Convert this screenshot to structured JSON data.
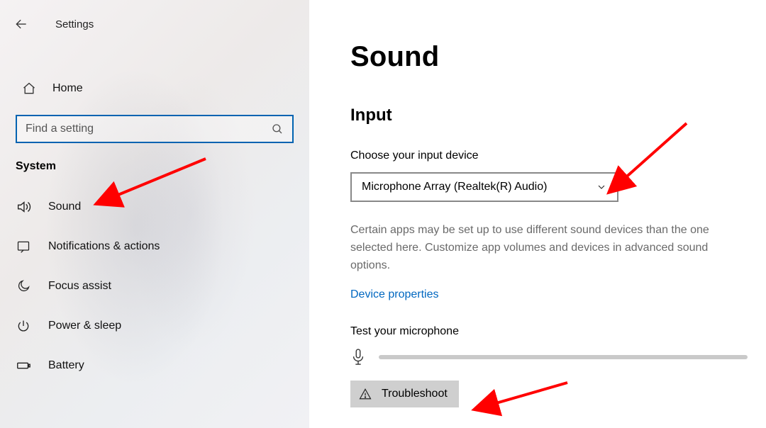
{
  "app": {
    "title": "Settings"
  },
  "sidebar": {
    "home_label": "Home",
    "search_placeholder": "Find a setting",
    "section_label": "System",
    "items": [
      {
        "label": "Sound"
      },
      {
        "label": "Notifications & actions"
      },
      {
        "label": "Focus assist"
      },
      {
        "label": "Power & sleep"
      },
      {
        "label": "Battery"
      }
    ]
  },
  "page": {
    "title": "Sound",
    "section": "Input",
    "choose_label": "Choose your input device",
    "device_selected": "Microphone Array (Realtek(R) Audio)",
    "help_text": "Certain apps may be set up to use different sound devices than the one selected here. Customize app volumes and devices in advanced sound options.",
    "device_properties_link": "Device properties",
    "test_label": "Test your microphone",
    "troubleshoot_label": "Troubleshoot"
  }
}
